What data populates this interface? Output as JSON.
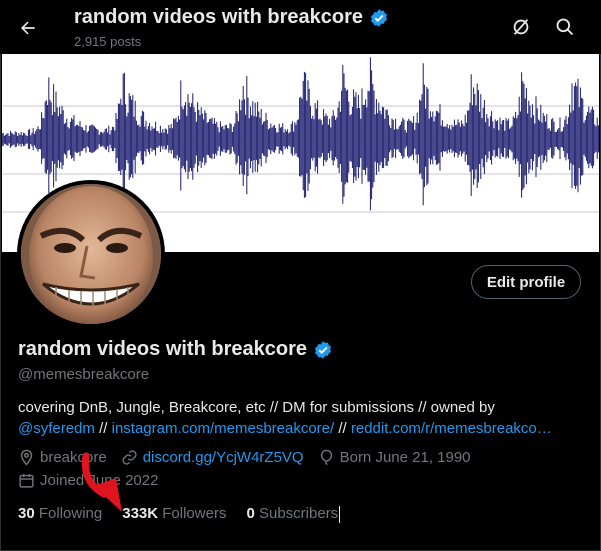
{
  "header": {
    "title": "random videos with breakcore",
    "posts": "2,915 posts",
    "back_icon": "arrow-left-icon",
    "right_icons": [
      "grok-icon",
      "search-icon"
    ]
  },
  "profile": {
    "name": "random videos with breakcore",
    "handle": "@memesbreakcore",
    "edit_button": "Edit profile",
    "bio_line1": "covering DnB, Jungle, Breakcore, etc // DM for submissions // owned by",
    "bio_mention": "@syferedm",
    "bio_sep1": "//",
    "bio_link1": "instagram.com/memesbreakcore/",
    "bio_sep2": "//",
    "bio_link2": "reddit.com/r/memesbreakco…",
    "location": "breakcore",
    "website": "discord.gg/YcjW4rZ5VQ",
    "born": "Born June 21, 1990",
    "joined": "Joined June 2022"
  },
  "stats": {
    "following_count": "30",
    "following_label": "Following",
    "followers_count": "333K",
    "followers_label": "Followers",
    "subscribers_count": "0",
    "subscribers_label": "Subscribers"
  },
  "colors": {
    "background": "#000000",
    "text": "#e7e9ea",
    "muted": "#71767b",
    "link": "#1d9bf0",
    "verified": "#1d9bf0",
    "waveform": "#1a1a6e",
    "annotation_arrow": "#e0141e"
  }
}
